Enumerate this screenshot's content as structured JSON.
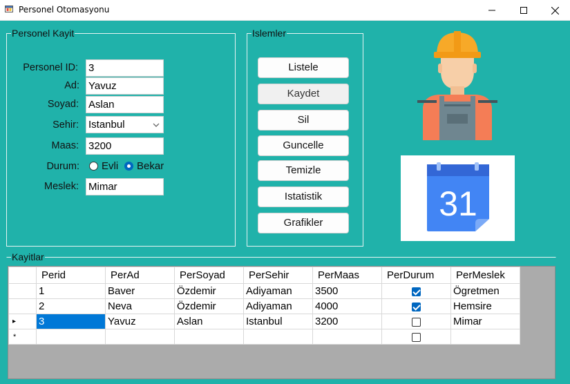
{
  "window": {
    "title": "Personel Otomasyonu",
    "controls": [
      "minimize-icon",
      "maximize-icon",
      "close-icon"
    ]
  },
  "personel_group": {
    "legend": "Personel Kayit",
    "fields": {
      "id": {
        "label": "Personel ID:",
        "value": "3"
      },
      "ad": {
        "label": "Ad:",
        "value": "Yavuz"
      },
      "soyad": {
        "label": "Soyad:",
        "value": "Aslan"
      },
      "sehir": {
        "label": "Sehir:",
        "value": "Istanbul"
      },
      "maas": {
        "label": "Maas:",
        "value": "3200"
      },
      "durum": {
        "label": "Durum:",
        "options": [
          "Evli",
          "Bekar"
        ],
        "selected": "Bekar"
      },
      "meslek": {
        "label": "Meslek:",
        "value": "Mimar"
      }
    }
  },
  "islemler_group": {
    "legend": "Islemler",
    "buttons": [
      "Listele",
      "Kaydet",
      "Sil",
      "Guncelle",
      "Temizle",
      "Istatistik",
      "Grafikler"
    ]
  },
  "images": {
    "worker": "construction-worker-icon",
    "calendar": {
      "icon": "calendar-icon",
      "day": "31"
    }
  },
  "records_group": {
    "legend": "Kayitlar",
    "columns": [
      "Perid",
      "PerAd",
      "PerSoyad",
      "PerSehir",
      "PerMaas",
      "PerDurum",
      "PerMeslek"
    ],
    "rows": [
      {
        "id": "1",
        "ad": "Baver",
        "soyad": "Özdemir",
        "sehir": "Adiyaman",
        "maas": "3500",
        "durum": true,
        "meslek": "Ögretmen"
      },
      {
        "id": "2",
        "ad": "Neva",
        "soyad": "Özdemir",
        "sehir": "Adiyaman",
        "maas": "4000",
        "durum": true,
        "meslek": "Hemsire"
      },
      {
        "id": "3",
        "ad": "Yavuz",
        "soyad": "Aslan",
        "sehir": "Istanbul",
        "maas": "3200",
        "durum": false,
        "meslek": "Mimar"
      }
    ],
    "current_row_marker": "▸",
    "new_row_marker": "*"
  },
  "colors": {
    "form_background": "#20b2aa",
    "selection": "#0078d7",
    "checkbox_accent": "#0067c0"
  }
}
